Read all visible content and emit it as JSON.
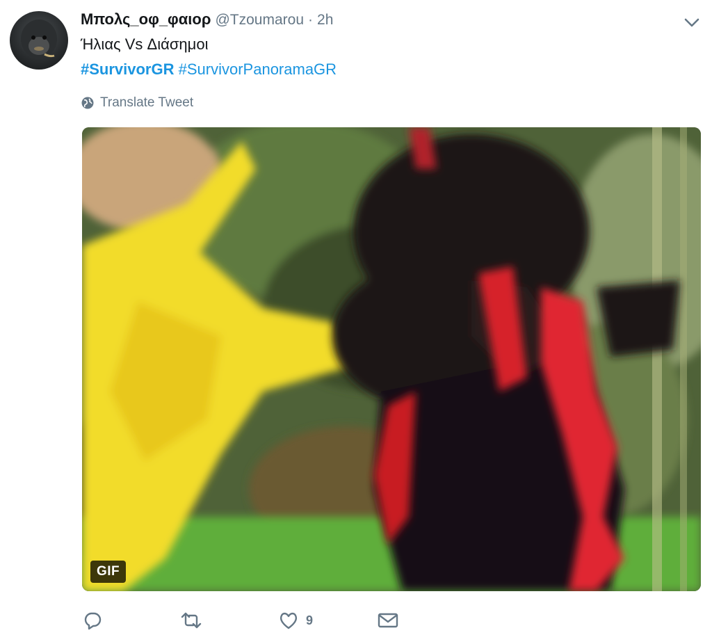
{
  "tweet": {
    "display_name": "Μπολς_οφ_φαιορ",
    "handle": "@Tzoumarou",
    "separator": "·",
    "time": "2h",
    "text": "Ήλιας Vs Διάσημοι",
    "hashtags": [
      "#SurvivorGR",
      "#SurvivorPanoramaGR"
    ],
    "translate_label": "Translate Tweet",
    "media_badge": "GIF",
    "like_count": "9"
  },
  "icons": {
    "avatar": "avatar-monkey-photo",
    "caret": "chevron-down-icon",
    "translate": "globe-icon",
    "reply": "reply-icon",
    "retweet": "retweet-icon",
    "like": "heart-icon",
    "dm": "envelope-icon"
  },
  "colors": {
    "link": "#1b95e0",
    "secondary_text": "#657786",
    "primary_text": "#14171a"
  }
}
